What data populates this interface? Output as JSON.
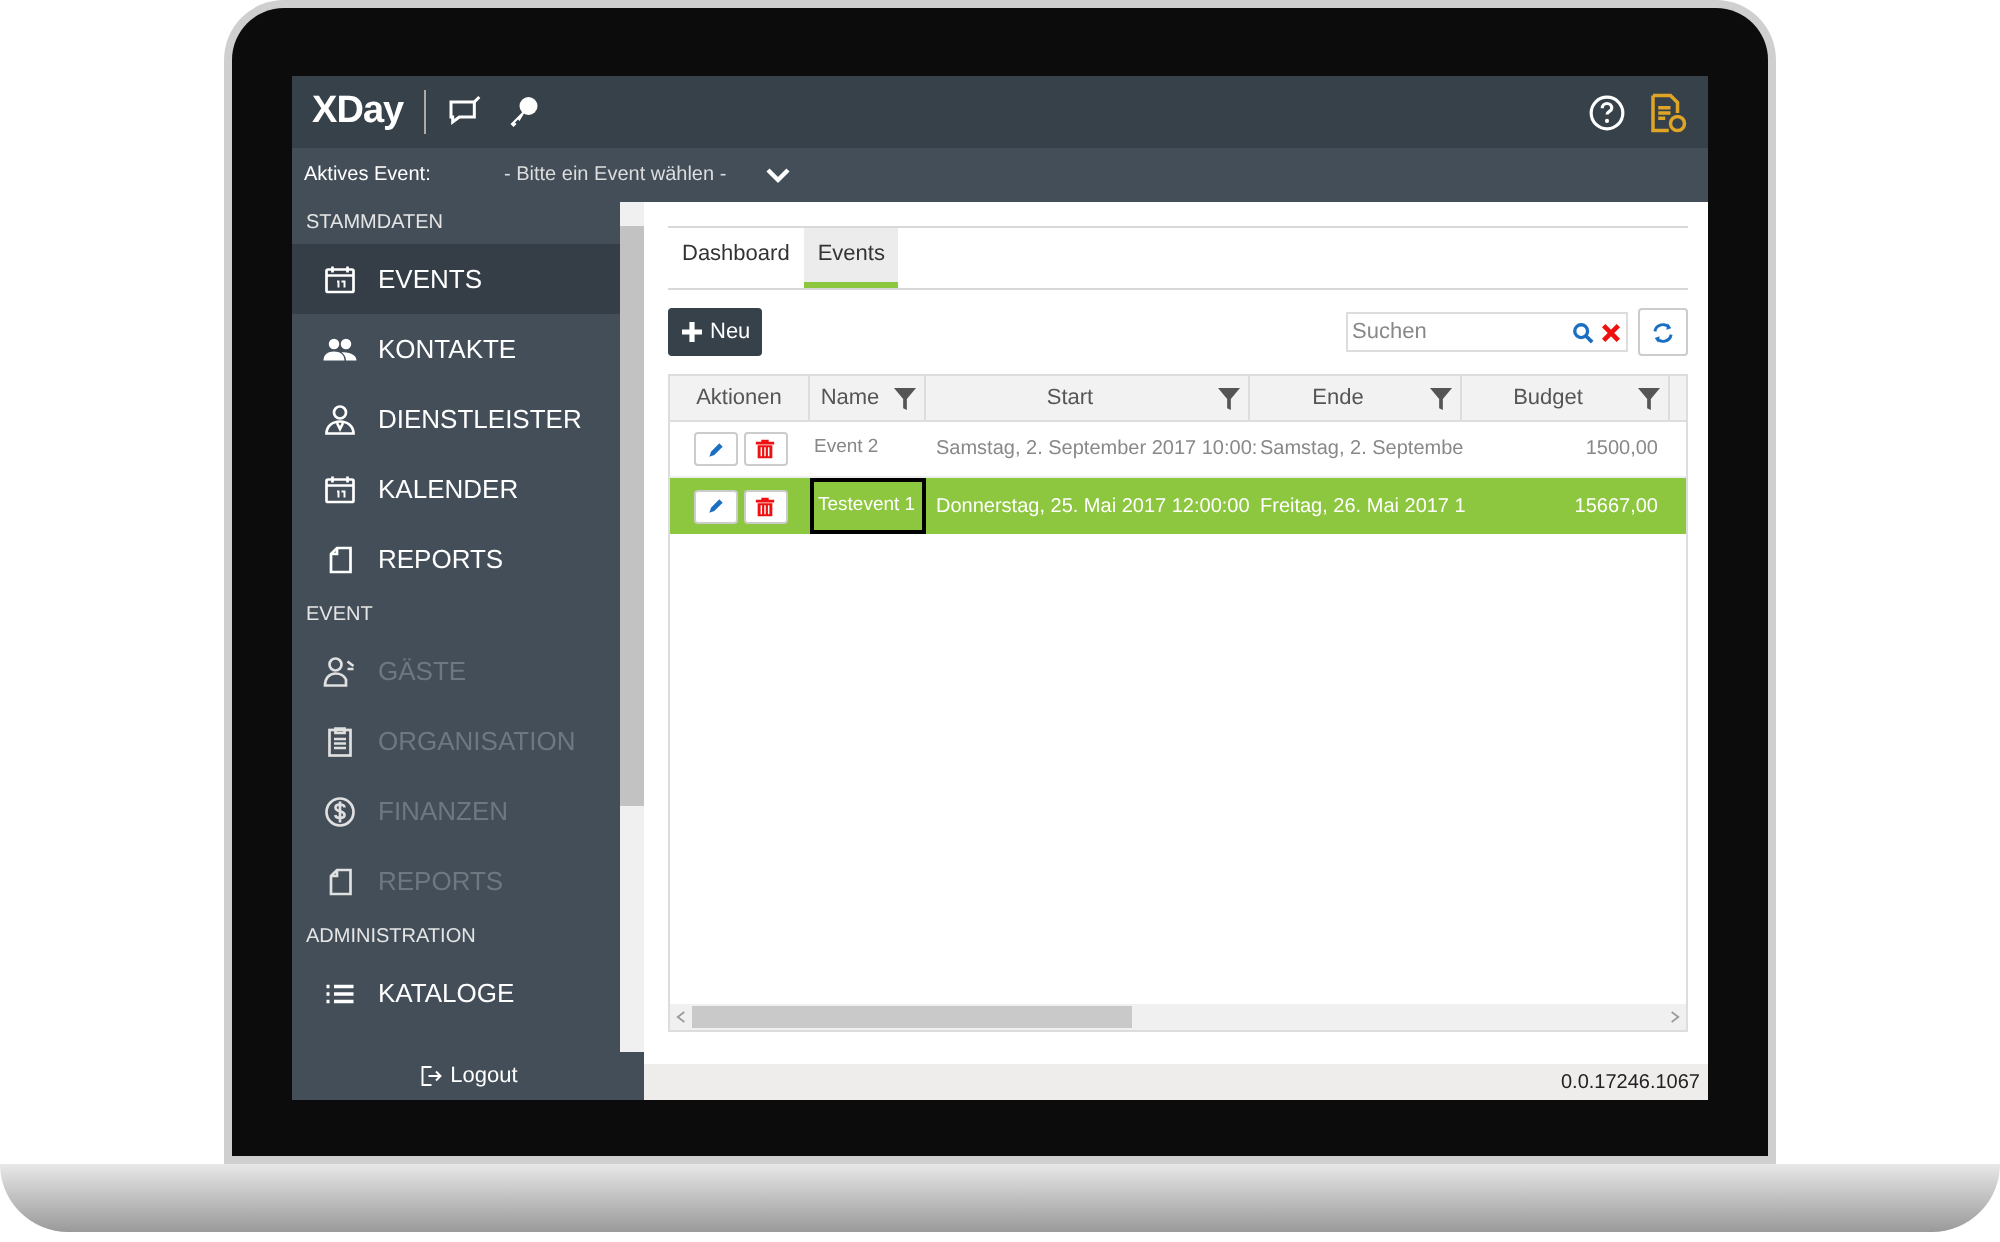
{
  "header": {
    "app_name": "XDay"
  },
  "active_event": {
    "label": "Aktives Event:",
    "value": "- Bitte ein Event wählen -"
  },
  "sidebar": {
    "sections": [
      {
        "title": "STAMMDATEN",
        "items": [
          {
            "label": "EVENTS",
            "selected": true,
            "disabled": false
          },
          {
            "label": "KONTAKTE",
            "selected": false,
            "disabled": false
          },
          {
            "label": "DIENSTLEISTER",
            "selected": false,
            "disabled": false
          },
          {
            "label": "KALENDER",
            "selected": false,
            "disabled": false
          },
          {
            "label": "REPORTS",
            "selected": false,
            "disabled": false
          }
        ]
      },
      {
        "title": "EVENT",
        "items": [
          {
            "label": "GÄSTE",
            "selected": false,
            "disabled": true
          },
          {
            "label": "ORGANISATION",
            "selected": false,
            "disabled": true
          },
          {
            "label": "FINANZEN",
            "selected": false,
            "disabled": true
          },
          {
            "label": "REPORTS",
            "selected": false,
            "disabled": true
          }
        ]
      },
      {
        "title": "ADMINISTRATION",
        "items": [
          {
            "label": "KATALOGE",
            "selected": false,
            "disabled": false
          }
        ]
      }
    ],
    "logout": "Logout"
  },
  "tabs": [
    {
      "label": "Dashboard",
      "selected": false
    },
    {
      "label": "Events",
      "selected": true
    }
  ],
  "toolbar": {
    "new_button": "Neu",
    "search": {
      "placeholder": "Suchen"
    }
  },
  "table": {
    "columns": [
      {
        "label": "Aktionen",
        "filter": false
      },
      {
        "label": "Name",
        "filter": true
      },
      {
        "label": "Start",
        "filter": true
      },
      {
        "label": "Ende",
        "filter": true
      },
      {
        "label": "Budget",
        "filter": true
      }
    ],
    "rows": [
      {
        "name": "Event 2",
        "start": "Samstag, 2. September 2017 10:00:",
        "end": "Samstag, 2. Septembe",
        "budget": "1500,00",
        "selected": false,
        "name_focused": false
      },
      {
        "name": "Testevent 1",
        "start": "Donnerstag, 25. Mai 2017 12:00:00",
        "end": "Freitag, 26. Mai 2017 1",
        "budget": "15667,00",
        "selected": true,
        "name_focused": true
      }
    ]
  },
  "status_bar": {
    "version": "0.0.17246.1067"
  }
}
